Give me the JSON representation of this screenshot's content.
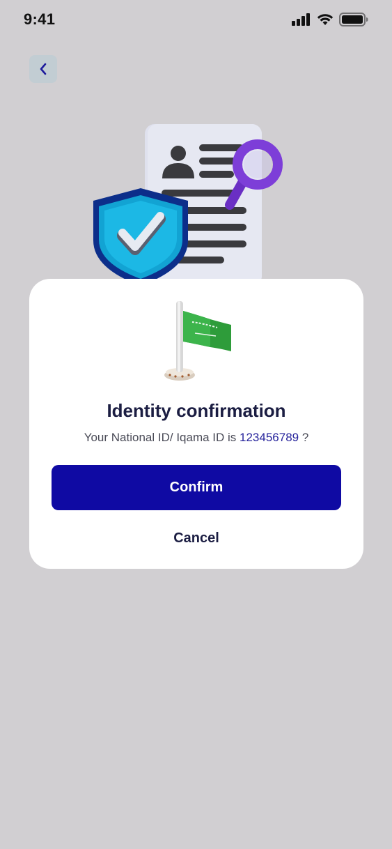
{
  "status_bar": {
    "time": "9:41",
    "icons": [
      "signal-icon",
      "wifi-icon",
      "battery-icon"
    ]
  },
  "header": {
    "back_icon": "chevron-left-icon"
  },
  "hero": {
    "illustration": "id-document-shield-magnifier-illustration"
  },
  "dialog": {
    "flag_icon": "saudi-flag-icon",
    "title": "Identity confirmation",
    "message_prefix": "Your National ID/ Iqama ID is ",
    "id_number": "123456789",
    "message_suffix": " ?",
    "confirm_label": "Confirm",
    "cancel_label": "Cancel"
  },
  "colors": {
    "background": "#d1cfd2",
    "primary": "#0f0aa3",
    "title_text": "#1b1d42",
    "id_highlight": "#27249c"
  }
}
